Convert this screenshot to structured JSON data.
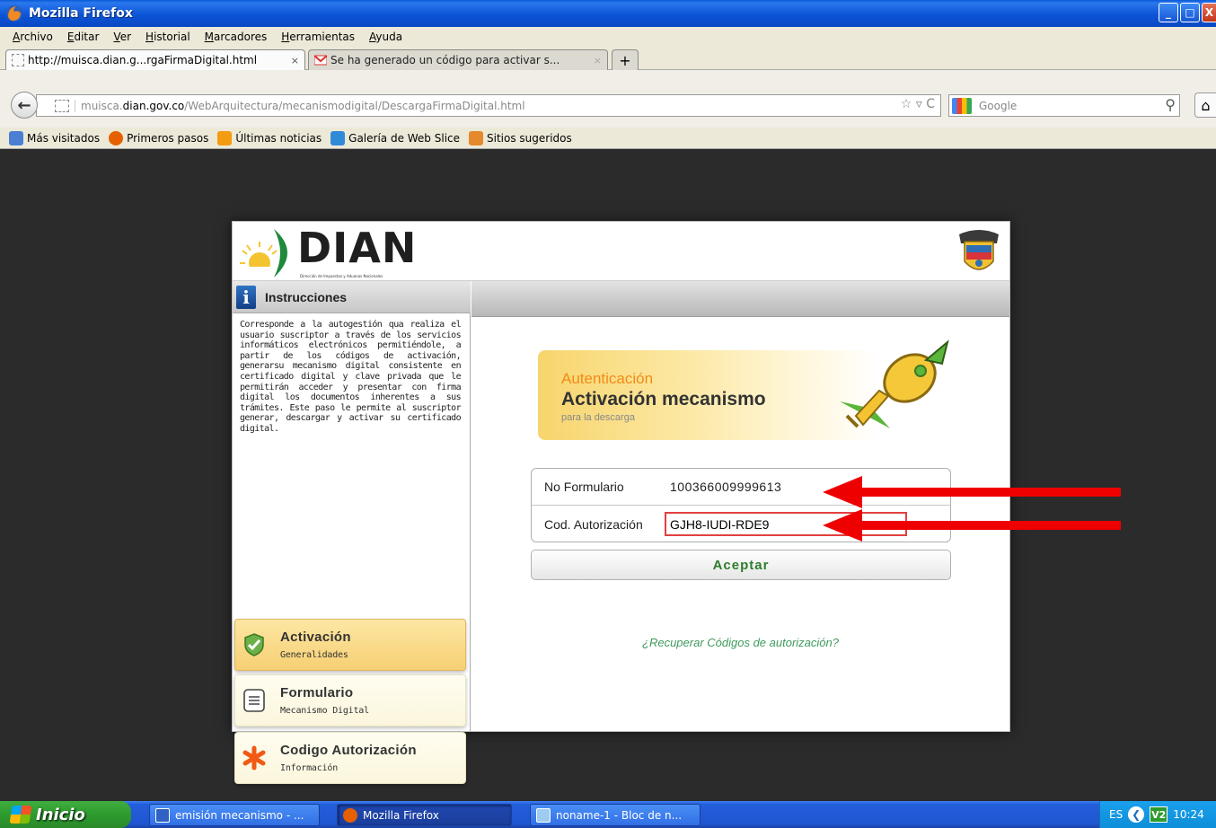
{
  "window": {
    "title": "Mozilla Firefox",
    "buttons": {
      "minimize": "_",
      "maximize": "□",
      "close": "X"
    }
  },
  "menubar": [
    "Archivo",
    "Editar",
    "Ver",
    "Historial",
    "Marcadores",
    "Herramientas",
    "Ayuda"
  ],
  "tabs": [
    {
      "label": "http://muisca.dian.g...rgaFirmaDigital.html",
      "close": "×",
      "icon": "blank-page-icon"
    },
    {
      "label": "Se ha generado un código para activar s...",
      "close": "×",
      "icon": "gmail-icon"
    }
  ],
  "new_tab": "+",
  "navigation": {
    "back": "←",
    "url_domain": "muisca.",
    "url_host": "dian.gov.co",
    "url_path": "/WebArquitectura/mecanismodigital/DescargaFirmaDigital.html",
    "url_tools": "☆ ▿ C",
    "search_placeholder": "Google",
    "search_icon": "⚲",
    "home": "⌂"
  },
  "bookmarks": [
    {
      "label": "Más visitados",
      "icon": "bookmark-folder-icon",
      "color": "#4a7fd4"
    },
    {
      "label": "Primeros pasos",
      "icon": "firefox-icon",
      "color": "#e66000"
    },
    {
      "label": "Últimas noticias",
      "icon": "rss-icon",
      "color": "#f39c12"
    },
    {
      "label": "Galería de Web Slice",
      "icon": "ie-icon",
      "color": "#2f8ad8"
    },
    {
      "label": "Sitios sugeridos",
      "icon": "lightbulb-icon",
      "color": "#e6892b"
    }
  ],
  "page": {
    "logo_text": "DIAN",
    "logo_subtitle": "Dirección de Impuestos y Aduanas Nacionales",
    "instructions_title": "Instrucciones",
    "instructions_icon": "i",
    "instructions_text": "Corresponde a la autogestión qua realiza el usuario suscriptor a través de los servicios informáticos electrónicos permitiéndole, a partir de los códigos de activación, generarsu mecanismo digital consistente en certificado digital y clave privada que le permitirán acceder y presentar con firma digital los documentos inherentes a sus trámites. Este paso le permite al suscriptor generar, descargar y activar su certificado digital.",
    "menu": [
      {
        "title": "Activación",
        "subtitle": "Generalidades",
        "icon": "checkmark-shield-icon",
        "active": true
      },
      {
        "title": "Formulario",
        "subtitle": "Mecanismo Digital",
        "icon": "document-icon",
        "active": false
      },
      {
        "title": "Codigo Autorización",
        "subtitle": "Información",
        "icon": "asterisk-icon",
        "active": false
      }
    ],
    "banner": {
      "line1": "Autenticación",
      "line2": "Activación mecanismo",
      "line3": "para la descarga"
    },
    "form": {
      "field1_label": "No Formulario",
      "field1_value": "100366009999613",
      "field2_label": "Cod. Autorización",
      "field2_value": "GJH8-IUDI-RDE9"
    },
    "submit_label": "Aceptar",
    "recover_link": "¿Recuperar Códigos de autorización?"
  },
  "taskbar": {
    "start": "Inicio",
    "items": [
      {
        "label": "emisión mecanismo - ...",
        "icon": "word-icon"
      },
      {
        "label": "Mozilla Firefox",
        "icon": "firefox-icon"
      },
      {
        "label": "noname-1 - Bloc de n...",
        "icon": "notepad-icon"
      }
    ],
    "tray_lang": "ES",
    "tray_chevron": "❮",
    "tray_app": "V2",
    "clock": "10:24"
  },
  "colors": {
    "accent_orange": "#f28b16",
    "link_green": "#3f9a5d",
    "button_green": "#2e7d2e",
    "annotation_red": "#ee0000"
  }
}
